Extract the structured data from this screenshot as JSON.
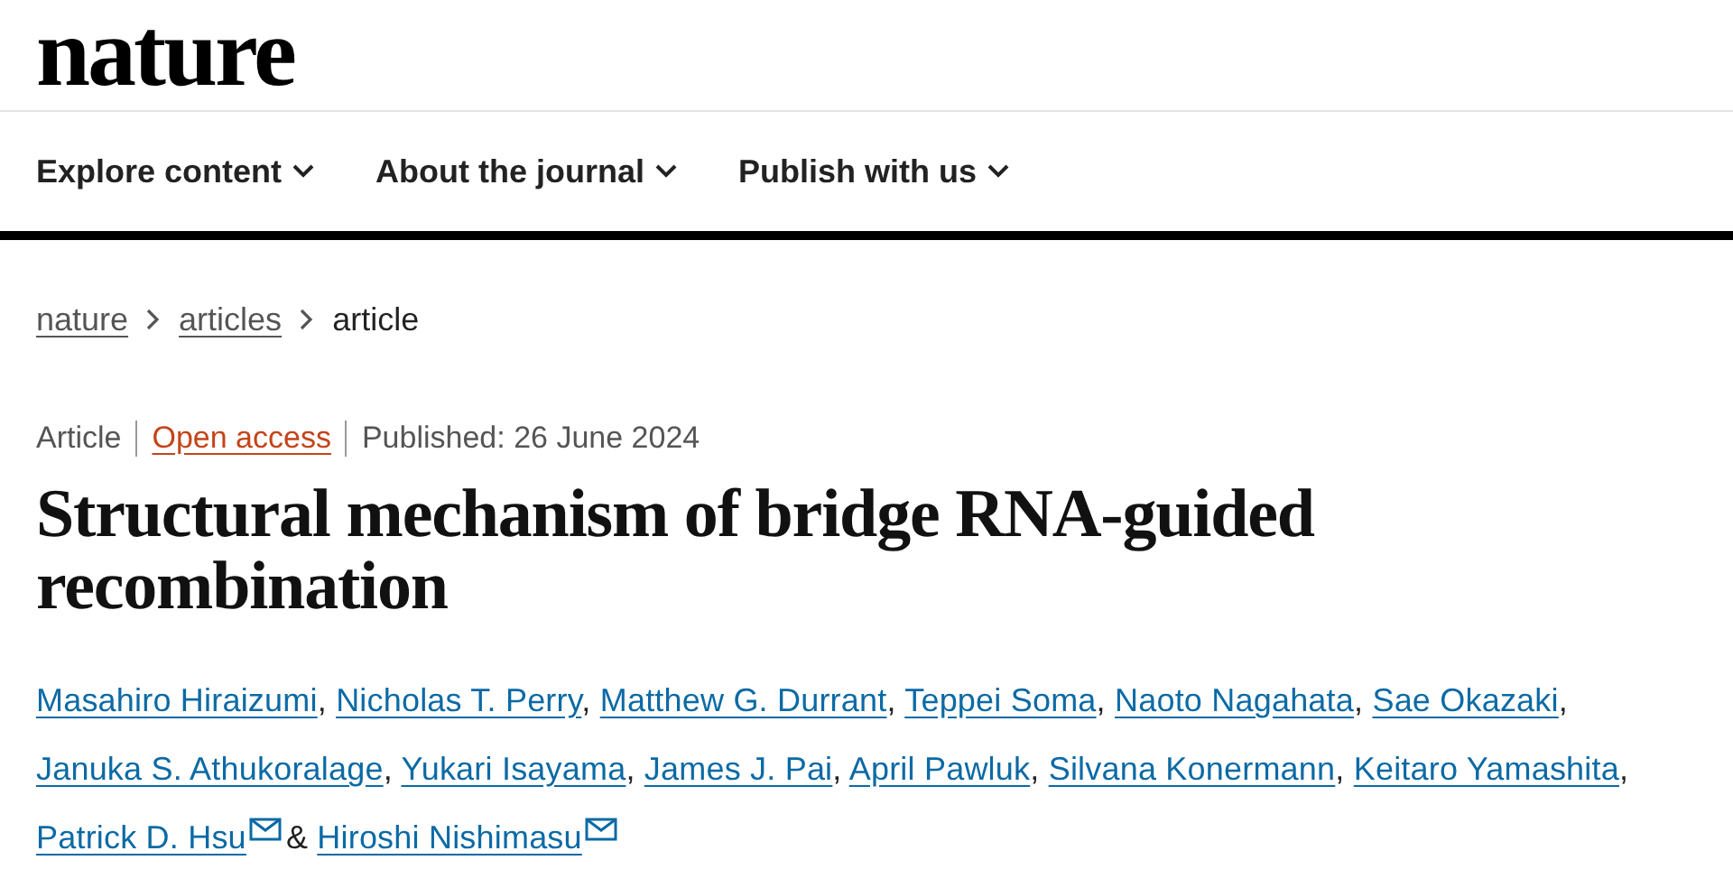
{
  "logo": "nature",
  "nav": [
    {
      "label": "Explore content"
    },
    {
      "label": "About the journal"
    },
    {
      "label": "Publish with us"
    }
  ],
  "breadcrumb": [
    {
      "label": "nature",
      "link": true
    },
    {
      "label": "articles",
      "link": true
    },
    {
      "label": "article",
      "link": false
    }
  ],
  "meta": [
    {
      "kind": "plain",
      "text": "Article"
    },
    {
      "kind": "link",
      "text": "Open access"
    },
    {
      "kind": "plain",
      "text": "Published: 26 June 2024"
    }
  ],
  "title": "Structural mechanism of bridge RNA-guided recombination",
  "authors": [
    {
      "name": "Masahiro Hiraizumi",
      "email": false,
      "separator": ","
    },
    {
      "name": "Nicholas T. Perry",
      "email": false,
      "separator": ","
    },
    {
      "name": "Matthew G. Durrant",
      "email": false,
      "separator": ","
    },
    {
      "name": "Teppei Soma",
      "email": false,
      "separator": ","
    },
    {
      "name": "Naoto Nagahata",
      "email": false,
      "separator": ","
    },
    {
      "name": "Sae Okazaki",
      "email": false,
      "separator": ","
    },
    {
      "name": "Januka S. Athukoralage",
      "email": false,
      "separator": ","
    },
    {
      "name": "Yukari Isayama",
      "email": false,
      "separator": ","
    },
    {
      "name": "James J. Pai",
      "email": false,
      "separator": ","
    },
    {
      "name": "April Pawluk",
      "email": false,
      "separator": ","
    },
    {
      "name": "Silvana Konermann",
      "email": false,
      "separator": ","
    },
    {
      "name": "Keitaro Yamashita",
      "email": false,
      "separator": ","
    },
    {
      "name": "Patrick D. Hsu",
      "email": true,
      "separator": "&"
    },
    {
      "name": "Hiroshi Nishimasu",
      "email": true
    }
  ]
}
